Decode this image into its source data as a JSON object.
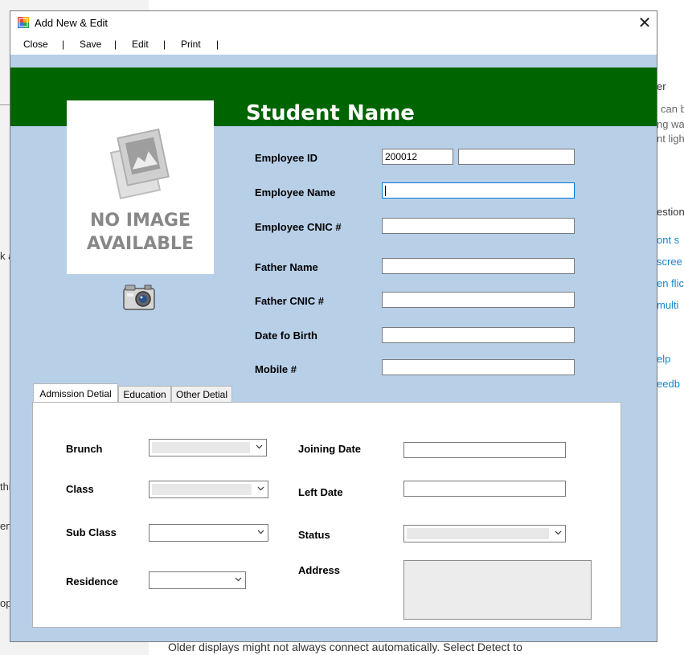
{
  "background": {
    "right_fragments": [
      "er",
      "can b",
      "ng wa",
      "nt ligh",
      "estion"
    ],
    "right_links": [
      "ont s",
      "scree",
      "en flic",
      "multi",
      "elp",
      "eedb"
    ],
    "left_fragments": [
      "k a",
      "this",
      "en",
      "op"
    ],
    "bottom_text": "Older displays might not always connect automatically. Select Detect to"
  },
  "window": {
    "title": "Add New & Edit",
    "close_glyph": "✕"
  },
  "menu": {
    "items": [
      "Close",
      "Save",
      "Edit",
      "Print"
    ],
    "separator": "|"
  },
  "header": {
    "student_name": "Student Name"
  },
  "photo": {
    "no_image_line1": "NO IMAGE",
    "no_image_line2": "AVAILABLE",
    "camera_icon": "camera-icon"
  },
  "form": {
    "employee_id_label": "Employee ID",
    "employee_id_value": "200012",
    "employee_id_extra": "",
    "employee_name_label": "Employee Name",
    "employee_name_value": "",
    "employee_cnic_label": "Employee CNIC #",
    "employee_cnic_value": "",
    "father_name_label": "Father Name",
    "father_name_value": "",
    "father_cnic_label": "Father CNIC #",
    "father_cnic_value": "",
    "dob_label": "Date fo Birth",
    "dob_value": "",
    "mobile_label": "Mobile #",
    "mobile_value": ""
  },
  "tabs": {
    "items": [
      "Admission Detial",
      "Education",
      "Other Detial"
    ],
    "active": "Admission Detial"
  },
  "admission": {
    "brunch_label": "Brunch",
    "class_label": "Class",
    "subclass_label": "Sub Class",
    "residence_label": "Residence",
    "joining_date_label": "Joining Date",
    "left_date_label": "Left Date",
    "status_label": "Status",
    "address_label": "Address",
    "joining_date_value": "",
    "left_date_value": ""
  },
  "colors": {
    "banner": "#006400",
    "window_bg": "#b8cfe8",
    "focus_border": "#0078d7"
  }
}
